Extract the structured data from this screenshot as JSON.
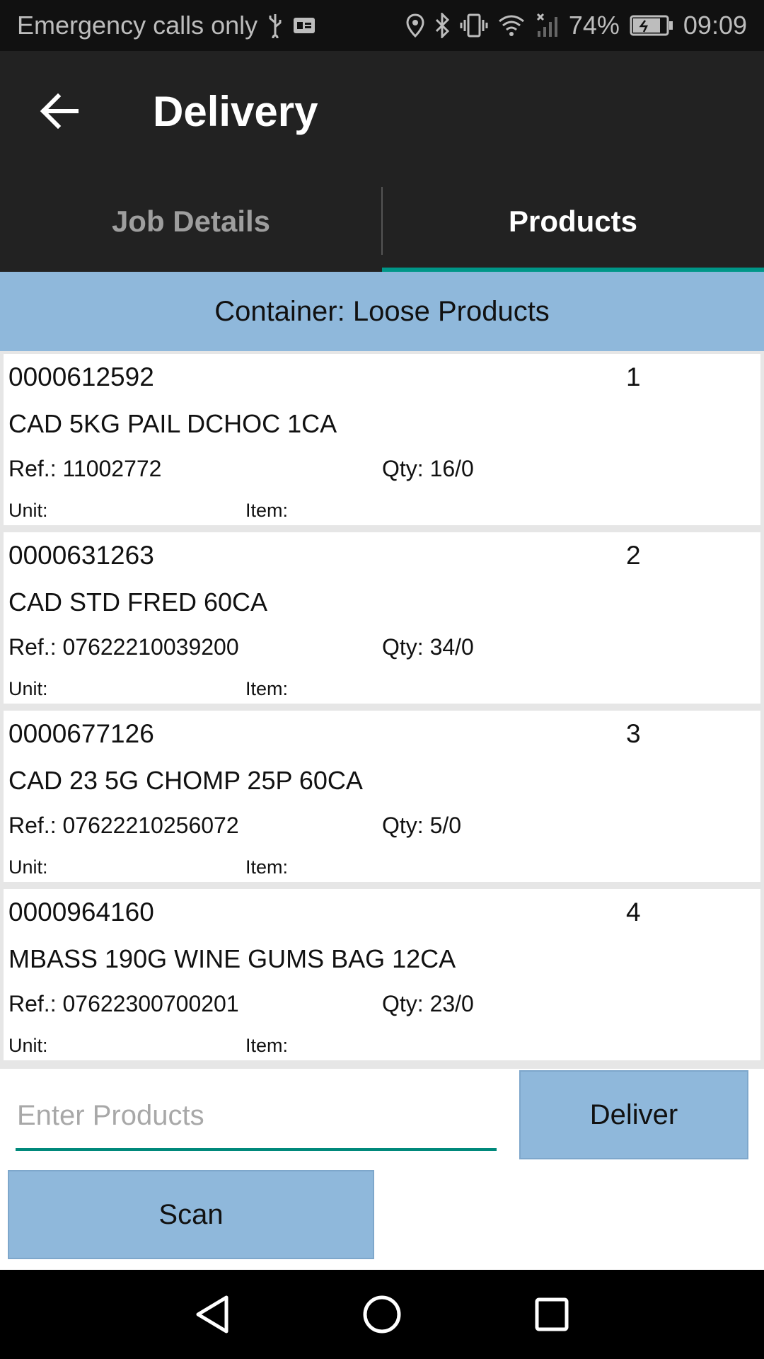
{
  "status_bar": {
    "carrier": "Emergency calls only",
    "battery": "74%",
    "time": "09:09",
    "icons": [
      "usb-icon",
      "sim-card-icon",
      "location-icon",
      "bluetooth-icon",
      "vibrate-icon",
      "wifi-icon",
      "signal-icon",
      "battery-icon"
    ]
  },
  "app_bar": {
    "title": "Delivery",
    "back_icon": "arrow-left-icon"
  },
  "tabs": [
    {
      "label": "Job Details",
      "active": false
    },
    {
      "label": "Products",
      "active": true
    }
  ],
  "container": {
    "label": "Container: Loose Products"
  },
  "products": [
    {
      "code": "0000612592",
      "index": "1",
      "description": "CAD 5KG PAIL DCHOC 1CA",
      "ref": "Ref.: 11002772",
      "qty": "Qty: 16/0",
      "unit": "Unit:",
      "item": "Item:"
    },
    {
      "code": "0000631263",
      "index": "2",
      "description": "CAD STD FRED 60CA",
      "ref": "Ref.: 07622210039200",
      "qty": "Qty: 34/0",
      "unit": "Unit:",
      "item": "Item:"
    },
    {
      "code": "0000677126",
      "index": "3",
      "description": "CAD 23 5G CHOMP 25P 60CA",
      "ref": "Ref.: 07622210256072",
      "qty": "Qty: 5/0",
      "unit": "Unit:",
      "item": "Item:"
    },
    {
      "code": "0000964160",
      "index": "4",
      "description": "MBASS 190G WINE GUMS BAG 12CA",
      "ref": "Ref.: 07622300700201",
      "qty": "Qty: 23/0",
      "unit": "Unit:",
      "item": "Item:"
    }
  ],
  "input": {
    "placeholder": "Enter Products",
    "value": ""
  },
  "buttons": {
    "deliver": "Deliver",
    "scan": "Scan"
  },
  "nav": [
    "back-triangle-icon",
    "home-circle-icon",
    "recents-square-icon"
  ],
  "colors": {
    "accent": "#009688",
    "header_blue": "#8fb8db",
    "app_bar": "#222222"
  }
}
